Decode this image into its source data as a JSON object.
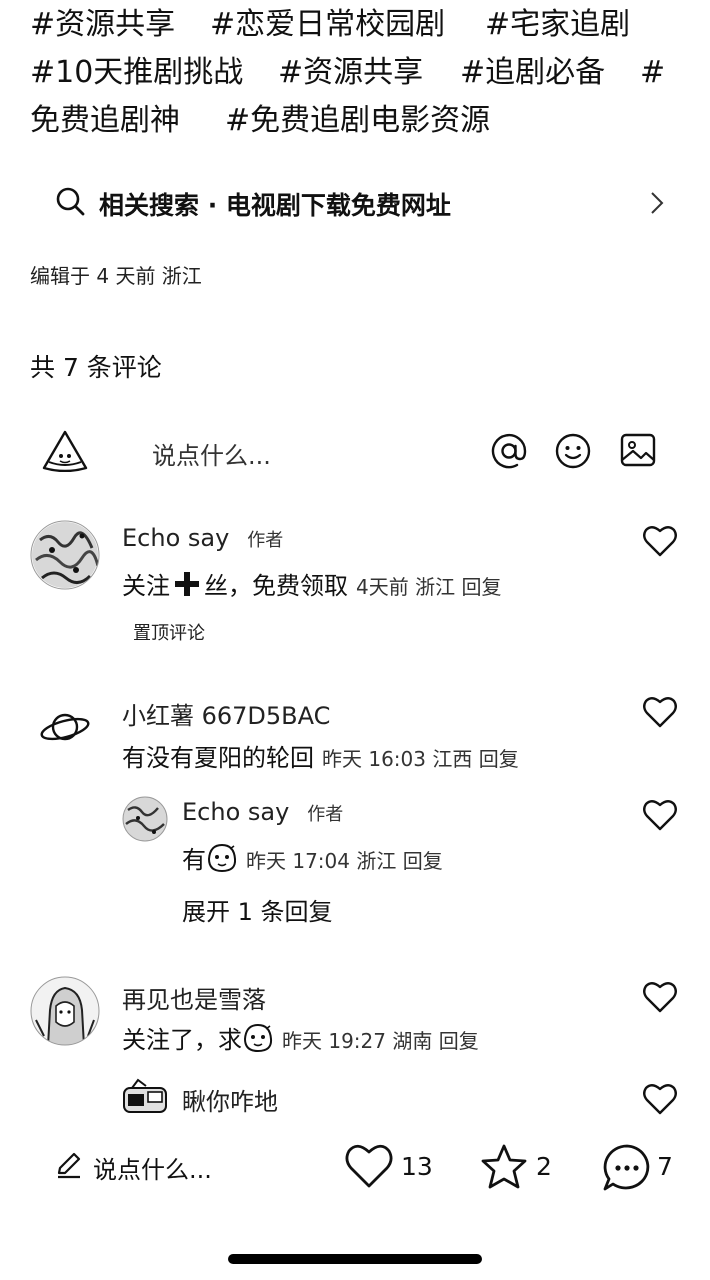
{
  "tags": {
    "line1": [
      "#资源共享",
      "#恋爱日常校园剧",
      "#宅家追剧"
    ],
    "line2": [
      "#10天推剧挑战",
      "#资源共享",
      "#追剧必备",
      "#"
    ],
    "line3": [
      "免费追剧神",
      "#免费追剧电影资源"
    ]
  },
  "related_search": {
    "label": "相关搜索 · 电视剧下载免费网址",
    "icon": "search-icon"
  },
  "post_meta": "编辑于 4 天前 浙江",
  "comment_count_label": "共 7 条评论",
  "comment_input": {
    "placeholder": "说点什么...",
    "icons": [
      "watermelon-icon",
      "at-icon",
      "smile-icon",
      "image-icon"
    ]
  },
  "comments": [
    {
      "name": "Echo say",
      "author_tag": "作者",
      "text_before": "关注",
      "text_after": "丝，免费领取",
      "meta": "4天前 浙江 回复",
      "pinned": "置顶评论",
      "replies": [],
      "liked": false
    },
    {
      "name": "小红薯 667D5BAC",
      "text": "有没有夏阳的轮回",
      "meta": "昨天 16:03 江西 回复",
      "replies": [
        {
          "name": "Echo say",
          "author_tag": "作者",
          "text": "有",
          "meta": "昨天 17:04 浙江 回复"
        }
      ],
      "expand_label": "展开 1 条回复"
    },
    {
      "name": "再见也是雪落",
      "text": "关注了，求",
      "meta": "昨天 19:27 湖南 回复",
      "replies": []
    },
    {
      "name": "瞅你咋地"
    }
  ],
  "bottom_bar": {
    "write_placeholder": "说点什么...",
    "likes": "13",
    "stars": "2",
    "comments": "7"
  },
  "colors": {
    "text": "#111111",
    "background": "#ffffff",
    "home_indicator": "#000000"
  }
}
